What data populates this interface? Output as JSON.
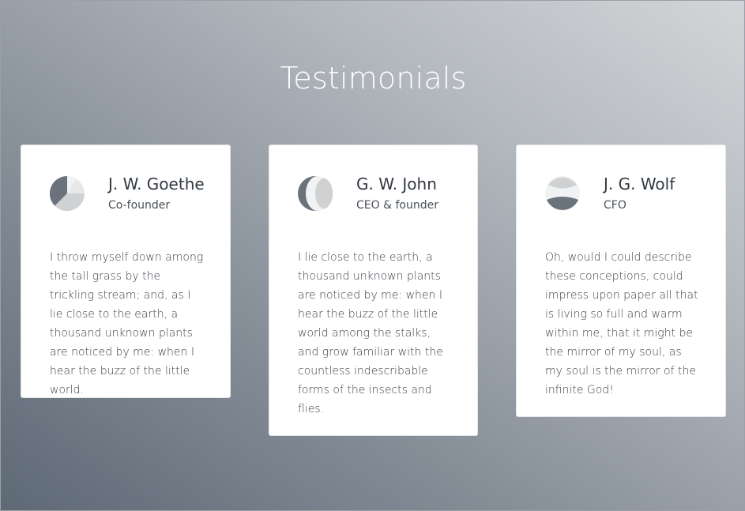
{
  "page": {
    "title": "Testimonials"
  },
  "testimonials": [
    {
      "name": "J. W. Goethe",
      "role": "Co-founder",
      "quote": "I throw myself down among the tall grass by the trickling stream; and, as I lie close to the earth, a thousand unknown plants are noticed by me: when I hear the buzz of the little world.",
      "avatar_icon": "pie-avatar-icon"
    },
    {
      "name": "G. W. John",
      "role": "CEO & founder",
      "quote": "I lie close to the earth, a thousand unknown plants are noticed by me: when I hear the buzz of the little world among the stalks, and grow familiar with the countless indescribable forms of the insects and flies.",
      "avatar_icon": "crescent-avatar-icon"
    },
    {
      "name": "J. G. Wolf",
      "role": "CFO",
      "quote": "Oh, would I could describe these conceptions, could impress upon paper all that is living so full and warm within me, that it might be the mirror of my soul, as my soul is the mirror of the infinite God!",
      "avatar_icon": "split-circle-avatar-icon"
    }
  ],
  "colors": {
    "avatar_dark": "#6a737c",
    "avatar_light": "#cfd1d3",
    "avatar_bg": "#f1f2f3",
    "card_bg": "#ffffff",
    "title_color": "#ffffff"
  }
}
